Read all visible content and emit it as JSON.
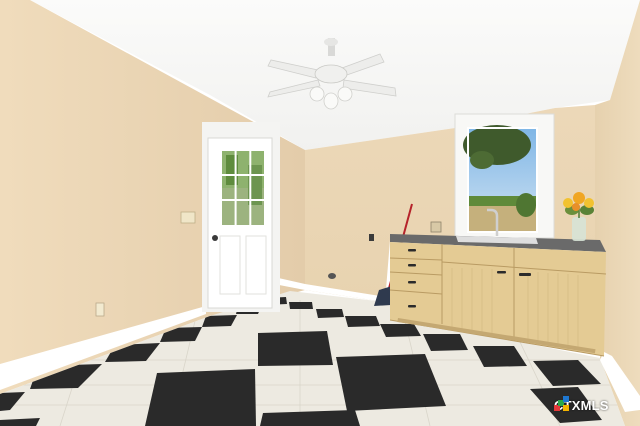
{
  "photo": {
    "subject": "laundry-room",
    "palette": {
      "wall": "#ecd9b8",
      "ceiling": "#f7f7f5",
      "floor_light": "#efece3",
      "floor_dark": "#2b2b2b",
      "cabinet": "#e3c992",
      "countertop": "#6b6b6b",
      "trim": "#ffffff"
    }
  },
  "watermark": {
    "text": "CTXMLS"
  }
}
